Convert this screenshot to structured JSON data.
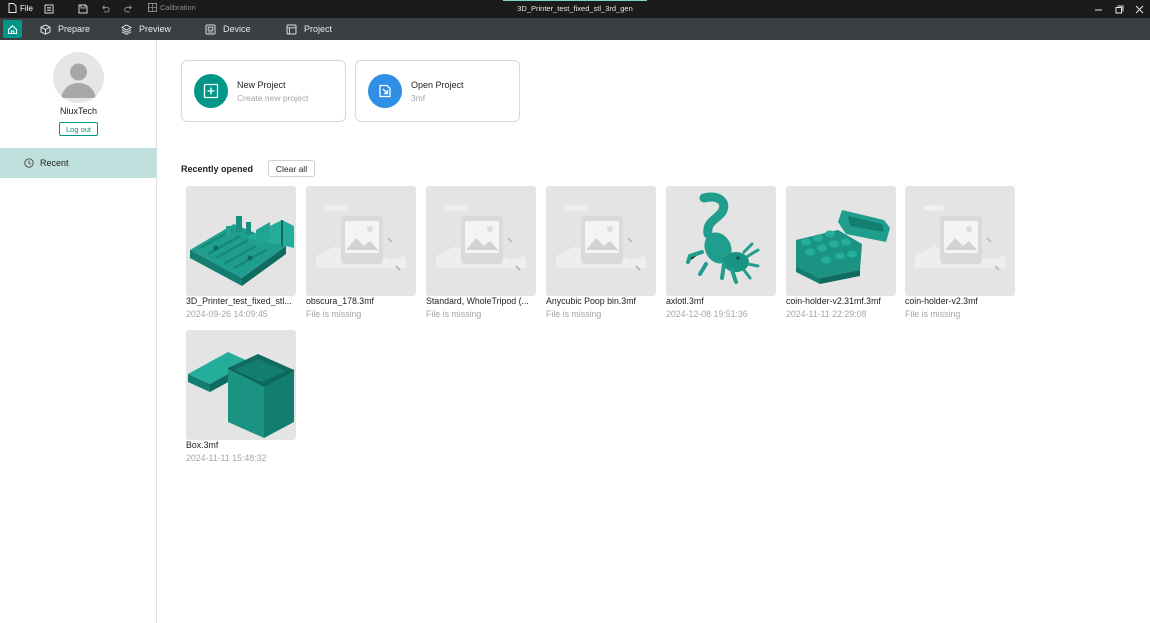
{
  "titlebar": {
    "file_label": "File",
    "calibration_label": "Calibration",
    "window_title": "3D_Printer_test_fixed_stl_3rd_gen"
  },
  "nav": {
    "items": [
      {
        "label": "Prepare",
        "icon": "cube-icon"
      },
      {
        "label": "Preview",
        "icon": "layers-icon"
      },
      {
        "label": "Device",
        "icon": "device-icon"
      },
      {
        "label": "Project",
        "icon": "project-icon"
      }
    ]
  },
  "sidebar": {
    "username": "NiuxTech",
    "logout_label": "Log out",
    "recent_label": "Recent"
  },
  "projects": {
    "new": {
      "title": "New Project",
      "subtitle": "Create new project"
    },
    "open": {
      "title": "Open Project",
      "subtitle": "3mf"
    }
  },
  "recent": {
    "title": "Recently opened",
    "clear_label": "Clear all",
    "files": [
      {
        "name": "3D_Printer_test_fixed_stl...",
        "date": "2024-09-26 14:09:45",
        "thumb": "test-print"
      },
      {
        "name": "obscura_178.3mf",
        "date": "File is missing",
        "thumb": "missing"
      },
      {
        "name": "Standard, WholeTripod (...",
        "date": "File is missing",
        "thumb": "missing"
      },
      {
        "name": "Anycubic Poop bin.3mf",
        "date": "File is missing",
        "thumb": "missing"
      },
      {
        "name": "axlotl.3mf",
        "date": "2024-12-08 19:51:36",
        "thumb": "axolotl"
      },
      {
        "name": "coin-holder-v2.31mf.3mf",
        "date": "2024-11-11 22:29:08",
        "thumb": "coin-holder"
      },
      {
        "name": "coin-holder-v2.3mf",
        "date": "File is missing",
        "thumb": "missing"
      },
      {
        "name": "Box.3mf",
        "date": "2024-11-11 15:48:32",
        "thumb": "box"
      }
    ]
  },
  "colors": {
    "accent": "#009688",
    "model": "#1f9e8e",
    "missing_text": "#a5a5a5",
    "open_icon": "#2f8fe6"
  }
}
